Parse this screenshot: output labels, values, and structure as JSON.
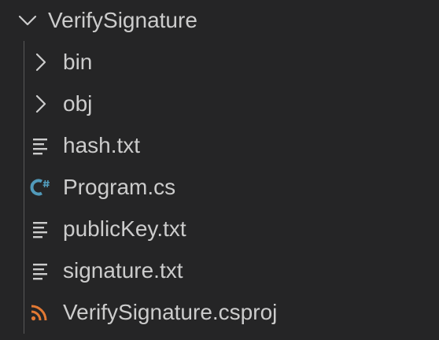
{
  "explorer": {
    "root": {
      "label": "VerifySignature",
      "icon": "chevron-down-icon",
      "expanded": true
    },
    "items": [
      {
        "label": "bin",
        "icon": "chevron-right-icon",
        "kind": "folder"
      },
      {
        "label": "obj",
        "icon": "chevron-right-icon",
        "kind": "folder"
      },
      {
        "label": "hash.txt",
        "icon": "text-file-icon",
        "kind": "file"
      },
      {
        "label": "Program.cs",
        "icon": "csharp-icon",
        "kind": "file"
      },
      {
        "label": "publicKey.txt",
        "icon": "text-file-icon",
        "kind": "file"
      },
      {
        "label": "signature.txt",
        "icon": "text-file-icon",
        "kind": "file"
      },
      {
        "label": "VerifySignature.csproj",
        "icon": "rss-icon",
        "kind": "file"
      }
    ]
  },
  "colors": {
    "background": "#252526",
    "text": "#cccccc",
    "indent_guide": "#585858",
    "csharp_accent": "#519aba",
    "csproj_accent": "#e37933"
  }
}
